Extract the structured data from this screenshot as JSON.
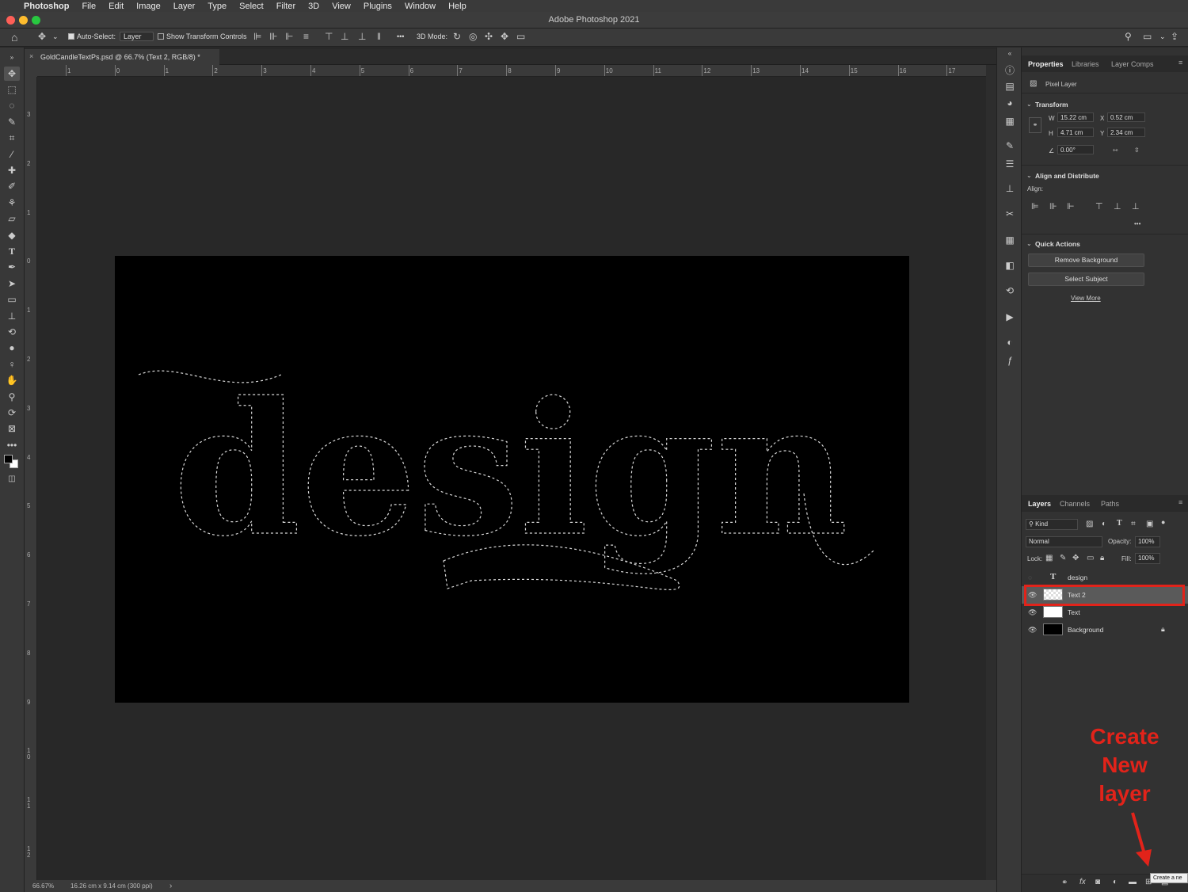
{
  "menubar": {
    "app": "Photoshop",
    "items": [
      "File",
      "Edit",
      "Image",
      "Layer",
      "Type",
      "Select",
      "Filter",
      "3D",
      "View",
      "Plugins",
      "Window",
      "Help"
    ]
  },
  "window": {
    "title": "Adobe Photoshop 2021"
  },
  "options_bar": {
    "auto_select_label": "Auto-Select:",
    "auto_select_value": "Layer",
    "show_transform_label": "Show Transform Controls",
    "mode_3d_label": "3D Mode:",
    "more": "•••"
  },
  "document_tab": {
    "label": "GoldCandleTextPs.psd @ 66.7% (Text 2, RGB/8) *",
    "close": "×"
  },
  "rulers": {
    "h_labels": [
      "1",
      "0",
      "1",
      "2",
      "3",
      "4",
      "5",
      "6",
      "7",
      "8",
      "9",
      "10",
      "11",
      "12",
      "13",
      "14",
      "15",
      "16",
      "17"
    ],
    "v_labels": [
      "3",
      "2",
      "1",
      "0",
      "1",
      "2",
      "3",
      "4",
      "5",
      "6",
      "7",
      "8",
      "9",
      "1\n0",
      "1\n1",
      "1\n2"
    ]
  },
  "canvas": {
    "text": "design",
    "background_color": "#000000"
  },
  "status_bar": {
    "zoom": "66.67%",
    "doc_info": "16.26 cm x 9.14 cm (300 ppi)",
    "arrow": "›"
  },
  "properties_panel": {
    "tabs": [
      "Properties",
      "Libraries",
      "Layer Comps"
    ],
    "kind": "Pixel Layer",
    "transform_title": "Transform",
    "w_label": "W",
    "w_value": "15.22 cm",
    "x_label": "X",
    "x_value": "0.52 cm",
    "h_label": "H",
    "h_value": "4.71 cm",
    "y_label": "Y",
    "y_value": "2.34 cm",
    "angle_value": "0.00°",
    "align_title": "Align and Distribute",
    "align_label": "Align:",
    "align_more": "•••",
    "quick_actions_title": "Quick Actions",
    "remove_bg": "Remove Background",
    "select_subject": "Select Subject",
    "view_more": "View More"
  },
  "layers_panel": {
    "tabs": [
      "Layers",
      "Channels",
      "Paths"
    ],
    "filter_kind": "Kind",
    "blend_mode": "Normal",
    "opacity_label": "Opacity:",
    "opacity_value": "100%",
    "lock_label": "Lock:",
    "fill_label": "Fill:",
    "fill_value": "100%",
    "layers": [
      {
        "name": "design",
        "type": "text",
        "visible": false,
        "selected": false
      },
      {
        "name": "Text 2",
        "type": "pixel",
        "visible": true,
        "selected": true
      },
      {
        "name": "Text",
        "type": "pixel",
        "visible": true,
        "selected": false
      },
      {
        "name": "Background",
        "type": "pixel",
        "visible": true,
        "selected": false,
        "locked": true
      }
    ],
    "footer_tooltip": "Create a ne"
  },
  "annotation": {
    "lines": [
      "Create",
      "New",
      "layer"
    ],
    "color": "#e2231a"
  },
  "colors": {
    "highlight": "#e2231a",
    "panel": "#323232",
    "canvas_bg": "#282828"
  }
}
